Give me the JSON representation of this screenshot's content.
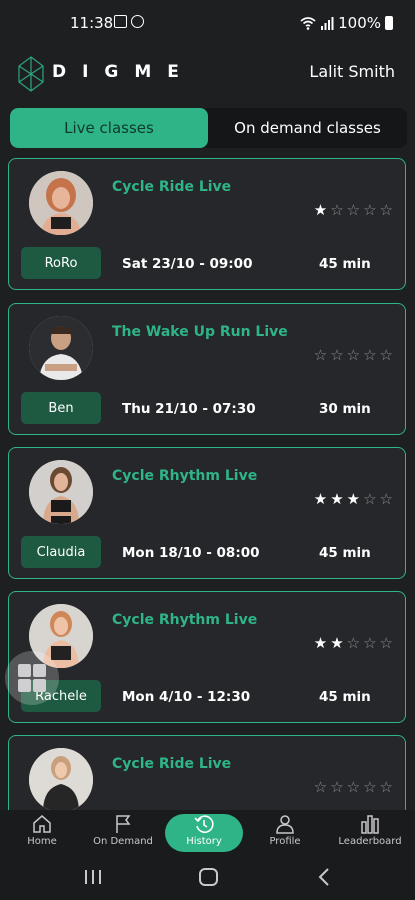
{
  "status_bar": {
    "time": "11:38",
    "battery": "100%"
  },
  "header": {
    "logo": "DIGME",
    "user_name": "Lalit Smith"
  },
  "tabs": [
    {
      "label": "Live classes",
      "active": true
    },
    {
      "label": "On demand classes",
      "active": false
    }
  ],
  "classes": [
    {
      "title": "Cycle Ride Live",
      "trainer": "RoRo",
      "datetime": "Sat 23/10 - 09:00",
      "duration": "45 min",
      "rating": 1
    },
    {
      "title": "The Wake Up Run Live",
      "trainer": "Ben",
      "datetime": "Thu 21/10 - 07:30",
      "duration": "30 min",
      "rating": 0
    },
    {
      "title": "Cycle Rhythm Live",
      "trainer": "Claudia",
      "datetime": "Mon 18/10 - 08:00",
      "duration": "45 min",
      "rating": 3
    },
    {
      "title": "Cycle Rhythm Live",
      "trainer": "Rachele",
      "datetime": "Mon 4/10 - 12:30",
      "duration": "45 min",
      "rating": 2
    },
    {
      "title": "Cycle Ride Live",
      "trainer": "",
      "datetime": "",
      "duration": "",
      "rating": 0
    }
  ],
  "bottom_nav": [
    {
      "label": "Home",
      "icon": "home-icon"
    },
    {
      "label": "On Demand",
      "icon": "flag-icon"
    },
    {
      "label": "History",
      "icon": "history-icon",
      "active": true
    },
    {
      "label": "Profile",
      "icon": "profile-icon"
    },
    {
      "label": "Leaderboard",
      "icon": "leaderboard-icon"
    }
  ],
  "colors": {
    "accent": "#2fb487",
    "background": "#1e1f21",
    "card": "#25272a",
    "trainer_badge": "#1d5a41"
  }
}
